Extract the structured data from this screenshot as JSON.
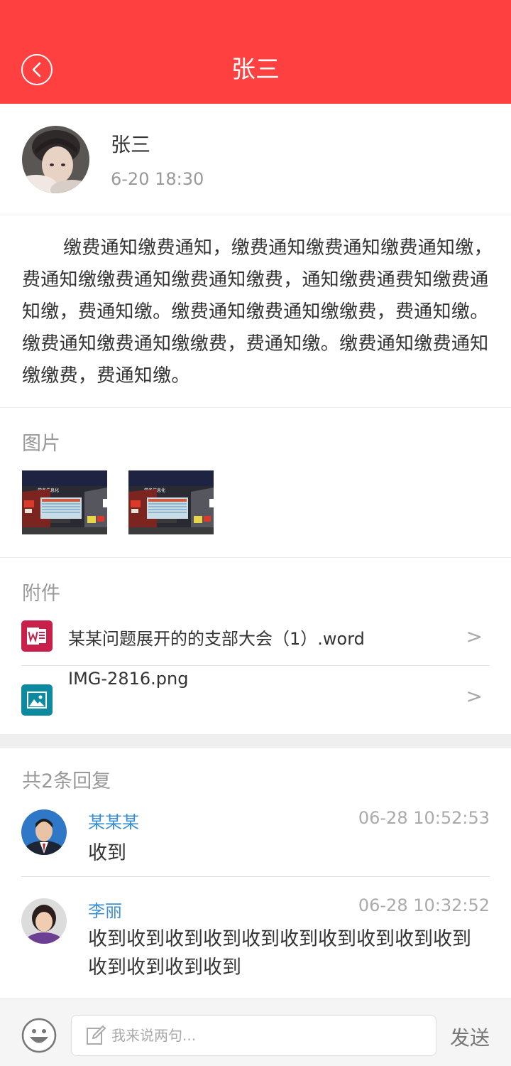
{
  "header": {
    "title": "张三",
    "back_icon": "chevron-left-icon",
    "bg_color": "#fe4140"
  },
  "post": {
    "author_name": "张三",
    "time": "6-20 18:30",
    "content": "缴费通知缴费通知，缴费通知缴费通知缴费通知缴，费通知缴缴费通知缴费通知缴费，通知缴费通费知缴费通知缴，费通知缴。缴费通知缴费通知缴缴费，费通知缴。缴费通知缴费通知缴缴费，费通知缴。缴费通知缴费通知缴缴费，费通知缴。"
  },
  "images": {
    "label": "图片",
    "thumb_caption": "党务信息化"
  },
  "attachments": {
    "label": "附件",
    "items": [
      {
        "name": "某某问题展开的的支部大会（1）.word",
        "icon": "word-file-icon",
        "arrow": ">"
      },
      {
        "name": "IMG-2816.png",
        "icon": "image-file-icon",
        "arrow": ">"
      }
    ]
  },
  "replies": {
    "count_label": "共2条回复",
    "items": [
      {
        "name": "某某某",
        "time": "06-28 10:52:53",
        "text": "收到"
      },
      {
        "name": "李丽",
        "time": "06-28 10:32:52",
        "text": "收到收到收到收到收到收到收到收到收到收到收到收到收到收到"
      }
    ]
  },
  "input_bar": {
    "placeholder": "我来说两句...",
    "send_label": "发送",
    "emoji_icon": "smiley-icon",
    "edit_icon": "pencil-icon"
  },
  "colors": {
    "accent": "#fe4140",
    "reply_name": "#3d8fd6",
    "muted": "#999999"
  }
}
